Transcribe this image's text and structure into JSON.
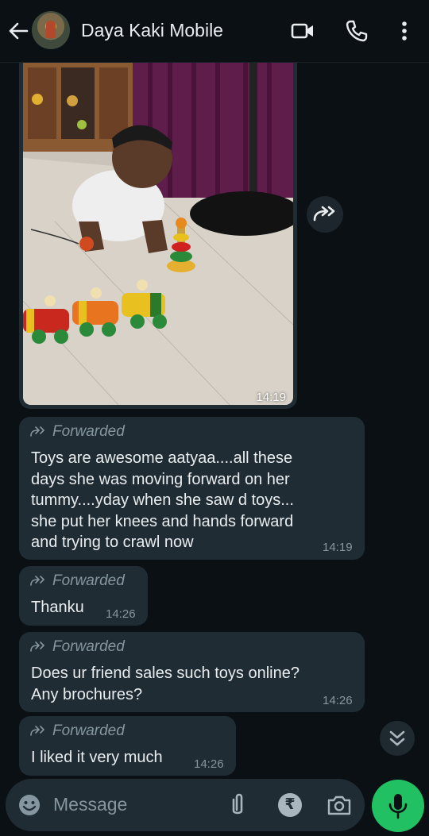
{
  "header": {
    "back_icon": "arrow-left-icon",
    "contact_name": "Daya Kaki Mobile",
    "video_icon": "video-call-icon",
    "call_icon": "phone-icon",
    "menu_icon": "more-vert-icon"
  },
  "messages": [
    {
      "type": "image",
      "time": "14:19"
    },
    {
      "type": "text",
      "forwarded_label": "Forwarded",
      "text": "Toys are awesome aatyaa....all these\ndays she was moving forward on her\ntummy....yday when she saw d toys...\nshe put her knees and hands forward\nand trying to crawl now",
      "time": "14:19"
    },
    {
      "type": "text",
      "forwarded_label": "Forwarded",
      "text": "Thanku",
      "time": "14:26"
    },
    {
      "type": "text",
      "forwarded_label": "Forwarded",
      "text": "Does ur friend sales such toys online?\nAny brochures?",
      "time": "14:26"
    },
    {
      "type": "text",
      "forwarded_label": "Forwarded",
      "text": "I liked it very much",
      "time": "14:26"
    }
  ],
  "composer": {
    "placeholder": "Message",
    "emoji_icon": "emoji-icon",
    "attach_icon": "paperclip-icon",
    "payment_icon": "rupee-icon",
    "payment_symbol": "₹",
    "camera_icon": "camera-icon",
    "mic_icon": "mic-icon"
  },
  "colors": {
    "background": "#0b1014",
    "bubble": "#202c33",
    "accent": "#21c063",
    "secondary_text": "#8696a0"
  }
}
